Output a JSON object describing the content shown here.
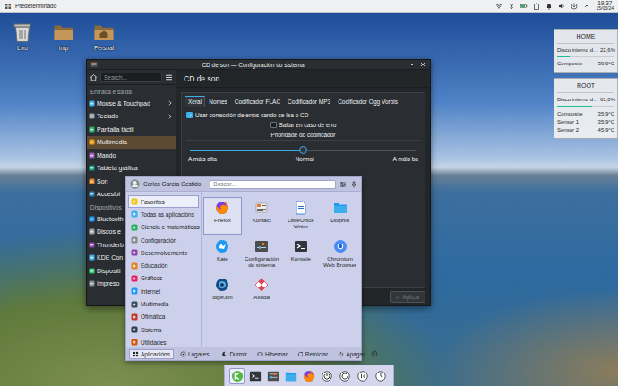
{
  "top_panel": {
    "activity": "Predeterminado",
    "time": "19:37",
    "date": "15/03/24"
  },
  "desktop_icons": [
    {
      "label": "Lixo"
    },
    {
      "label": "tmp"
    },
    {
      "label": "Persoal"
    }
  ],
  "widgets": [
    {
      "title": "HOME",
      "rows": [
        {
          "kind": "meter",
          "label": "Disco interno d…",
          "value": "22,6%",
          "level": 0.226
        },
        {
          "kind": "sensor",
          "label": "Composite",
          "value": "39,9°C"
        }
      ]
    },
    {
      "title": "ROOT",
      "rows": [
        {
          "kind": "meter",
          "label": "Disco interno d…",
          "value": "61,0%",
          "level": 0.61
        },
        {
          "kind": "sensor",
          "label": "Composite",
          "value": "35,9°C"
        },
        {
          "kind": "sensor",
          "label": "Sensor 1",
          "value": "35,9°C"
        },
        {
          "kind": "sensor",
          "label": "Sensor 2",
          "value": "45,9°C"
        }
      ]
    }
  ],
  "settings": {
    "title": "CD de son — Configuración do sistema",
    "search": {
      "placeholder": "Search..."
    },
    "sidebar": [
      {
        "header": "Entrada e saída",
        "items": [
          {
            "label": "Mouse & Touchpad",
            "has_children": true,
            "selected": false
          },
          {
            "label": "Teclado",
            "has_children": true,
            "selected": false
          },
          {
            "label": "Pantalla táctil",
            "has_children": false,
            "selected": false
          },
          {
            "label": "Multimedia",
            "has_children": false,
            "selected": true
          },
          {
            "label": "Mando",
            "has_children": false,
            "selected": false
          },
          {
            "label": "Tableta gráfica",
            "has_children": false,
            "selected": false
          },
          {
            "label": "Son",
            "has_children": false,
            "selected": false
          },
          {
            "label": "Accesibi",
            "has_children": false,
            "selected": false
          }
        ]
      },
      {
        "header": "Dispositivos",
        "items": [
          {
            "label": "Bluetooth",
            "has_children": false,
            "selected": false
          },
          {
            "label": "Discos e",
            "has_children": false,
            "selected": false
          },
          {
            "label": "Thunderb",
            "has_children": false,
            "selected": false
          },
          {
            "label": "KDE Con",
            "has_children": false,
            "selected": false
          },
          {
            "label": "Dispositi",
            "has_children": false,
            "selected": false
          },
          {
            "label": "Impreso",
            "has_children": false,
            "selected": false
          }
        ]
      }
    ],
    "page_title": "CD de son",
    "tabs": [
      {
        "label": "Xeral",
        "selected": true
      },
      {
        "label": "Nomes",
        "selected": false
      },
      {
        "label": "Codificador FLAC",
        "selected": false
      },
      {
        "label": "Codificador MP3",
        "selected": false
      },
      {
        "label": "Codificador Ogg Vorbis",
        "selected": false
      }
    ],
    "options": [
      {
        "kind": "checkbox",
        "label": "Usar corrección de erros cando se lea o CD",
        "checked": true
      },
      {
        "kind": "checkbox",
        "label": "Saltar en caso de erro",
        "checked": false
      },
      {
        "kind": "heading",
        "label": "Prioridade do codificador"
      },
      {
        "kind": "slider",
        "level": 0.5,
        "ticks": [
          "A máis alta",
          "Normal",
          "A máis ba"
        ]
      }
    ],
    "apply_button": {
      "label": "Aplicar",
      "disabled": true
    }
  },
  "launcher": {
    "user": "Carlos García Gestido",
    "search": {
      "placeholder": "Buscar..."
    },
    "categories": [
      {
        "label": "Favoritos",
        "selected": true
      },
      {
        "label": "Todas as aplicacións",
        "selected": false
      },
      {
        "label": "Ciencia e matemáticas",
        "selected": false
      },
      {
        "label": "Configuración",
        "selected": false
      },
      {
        "label": "Desenvolvemento",
        "selected": false
      },
      {
        "label": "Educación",
        "selected": false
      },
      {
        "label": "Gráficos",
        "selected": false
      },
      {
        "label": "Internet",
        "selected": false
      },
      {
        "label": "Multimedia",
        "selected": false
      },
      {
        "label": "Ofimática",
        "selected": false
      },
      {
        "label": "Sistema",
        "selected": false
      },
      {
        "label": "Utilidades",
        "selected": false
      }
    ],
    "apps": [
      {
        "label": "Firefox",
        "selected": true
      },
      {
        "label": "Kontact",
        "selected": false
      },
      {
        "label": "LibreOffice Writer",
        "selected": false
      },
      {
        "label": "Dolphin",
        "selected": false
      },
      {
        "label": "Kate",
        "selected": false
      },
      {
        "label": "Configuración do sistema",
        "selected": false
      },
      {
        "label": "Konsole",
        "selected": false
      },
      {
        "label": "Chromium Web Browser",
        "selected": false
      },
      {
        "label": "digiKam",
        "selected": false
      },
      {
        "label": "Axuda",
        "selected": false
      }
    ],
    "tabs": [
      {
        "label": "Aplicacións",
        "selected": true
      },
      {
        "label": "Lugares",
        "selected": false
      }
    ],
    "power": [
      {
        "label": "Durmir"
      },
      {
        "label": "Hibernar"
      },
      {
        "label": "Reiniciar"
      },
      {
        "label": "Apagar"
      }
    ]
  },
  "taskbar": {
    "items": [
      {
        "selected": true
      },
      {
        "selected": false
      },
      {
        "selected": false
      },
      {
        "selected": false
      },
      {
        "selected": false
      },
      {
        "selected": false
      },
      {
        "selected": false
      },
      {
        "selected": false
      },
      {
        "selected": false
      }
    ]
  }
}
